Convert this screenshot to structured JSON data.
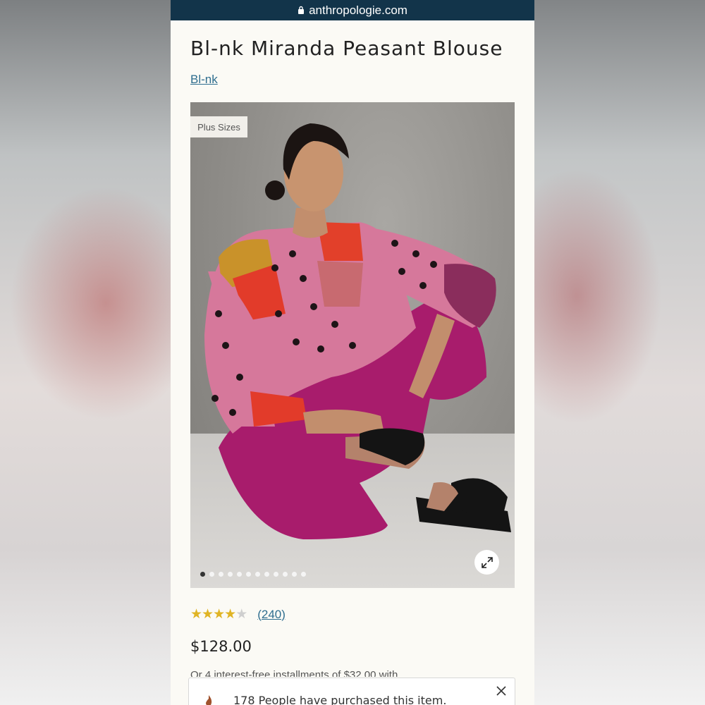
{
  "browser": {
    "url": "anthropologie.com"
  },
  "product": {
    "title": "Bl-nk Miranda Peasant Blouse",
    "brand": "Bl-nk",
    "badge": "Plus Sizes",
    "image_count": 12,
    "active_image": 1,
    "rating": 3.5,
    "review_count": "(240)",
    "price": "$128.00",
    "installments_text": "Or 4 interest-free installments of $32.00 with"
  },
  "toast": {
    "message": "178 People have purchased this item."
  },
  "icons": {
    "lock": "lock-icon",
    "expand": "expand-icon",
    "close": "close-icon",
    "star": "star-icon",
    "flame": "flame-icon"
  },
  "colors": {
    "url_bar": "#12344a",
    "link": "#2f6e8f",
    "star": "#e0b424",
    "page_bg": "#fbfaf5"
  }
}
